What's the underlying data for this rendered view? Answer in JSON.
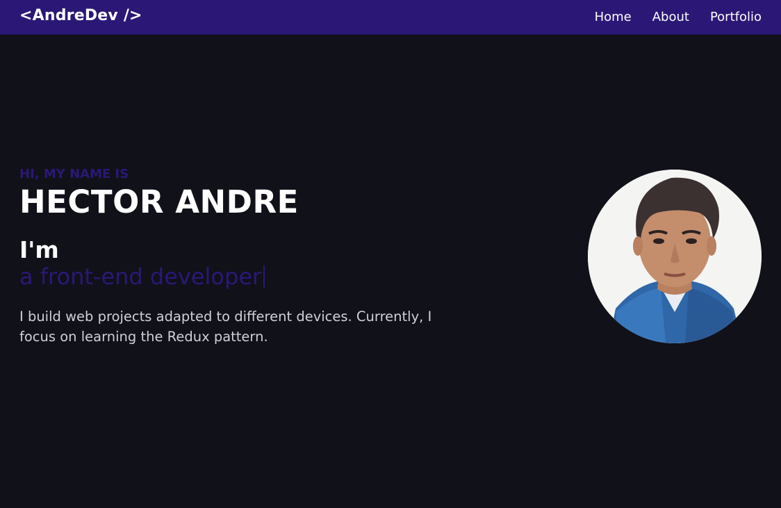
{
  "navbar": {
    "logo": "<AndreDev />",
    "links": [
      "Home",
      "About",
      "Portfolio"
    ]
  },
  "hero": {
    "greeting": "HI, MY NAME IS",
    "name": "HECTOR ANDRE",
    "intro": "I'm",
    "role": "a front-end developer",
    "bio": "I build web projects adapted to different devices. Currently, I focus on learning the Redux pattern."
  },
  "colors": {
    "accent": "#2b1876",
    "background": "#11111a",
    "text": "#ffffff",
    "muted_text": "#d0d0d6"
  },
  "icons": {
    "avatar": "profile-photo"
  }
}
